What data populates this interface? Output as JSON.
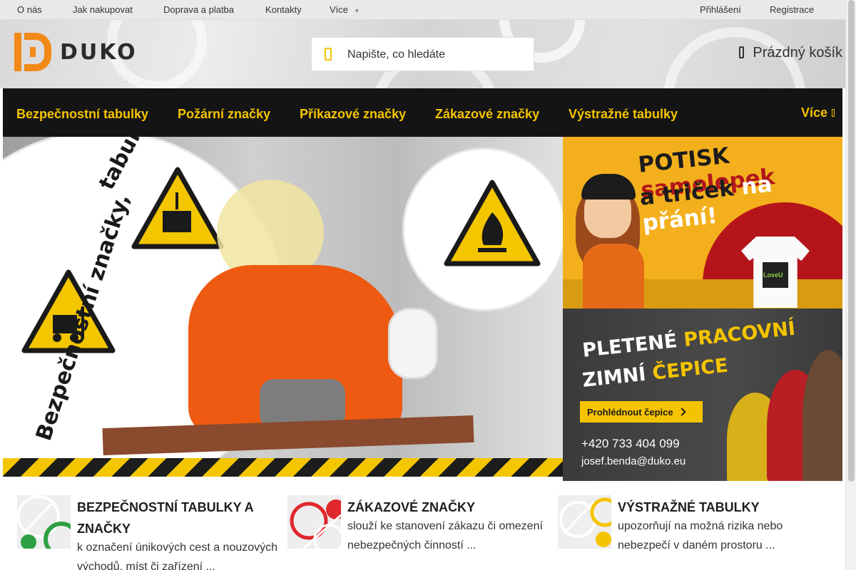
{
  "topbar": {
    "left_links": [
      "O nás",
      "Jak nakupovat",
      "Doprava a platba",
      "Kontakty",
      "Více"
    ],
    "right_links": [
      "Přihlášení",
      "Registrace"
    ]
  },
  "header": {
    "logo_text": "DUKO",
    "search_placeholder": "Napište, co hledáte",
    "cart_label": "Prázdný košík"
  },
  "nav": {
    "items": [
      "Bezpečnostní tabulky",
      "Požární značky",
      "Příkazové značky",
      "Zákazové značky",
      "Výstražné tabulky"
    ],
    "more": "Více"
  },
  "hero": {
    "arc_top": "tabulky a symboly",
    "arc_mid": "Bezpečnostní značky,"
  },
  "promo1": {
    "line1_black": "POTISK ",
    "line1_red": "samolepek",
    "line2_black": "a triček ",
    "line2_white": "na přání!",
    "shirt_print": "LoveU"
  },
  "promo2": {
    "line1_white": "PLETENÉ ",
    "line1_yellow": "PRACOVNÍ",
    "line2_white": "ZIMNÍ ",
    "line2_yellow": "ČEPICE",
    "button": "Prohlédnout čepice",
    "phone": "+420 733 404 099",
    "email": "josef.benda@duko.eu"
  },
  "categories": [
    {
      "title": "BEZPEČNOSTNÍ TABULKY A ZNAČKY",
      "desc": "k označení únikových cest a nouzových východů, míst či zařízení ..."
    },
    {
      "title": "ZÁKAZOVÉ ZNAČKY",
      "desc": "slouží ke stanovení zákazu či omezení nebezpečných činností ..."
    },
    {
      "title": "VÝSTRAŽNÉ TABULKY",
      "desc": "upozorňují na možná rizika nebo nebezpečí v daném prostoru ..."
    }
  ],
  "colors": {
    "accent_yellow": "#f5c400",
    "nav_bg": "#141414",
    "logo_orange": "#f28a1a",
    "promo_orange": "#f4b01c",
    "promo_red": "#b3171b"
  },
  "icons": {
    "search": "search-icon",
    "cart": "cart-icon",
    "more": "caret-down-icon"
  }
}
